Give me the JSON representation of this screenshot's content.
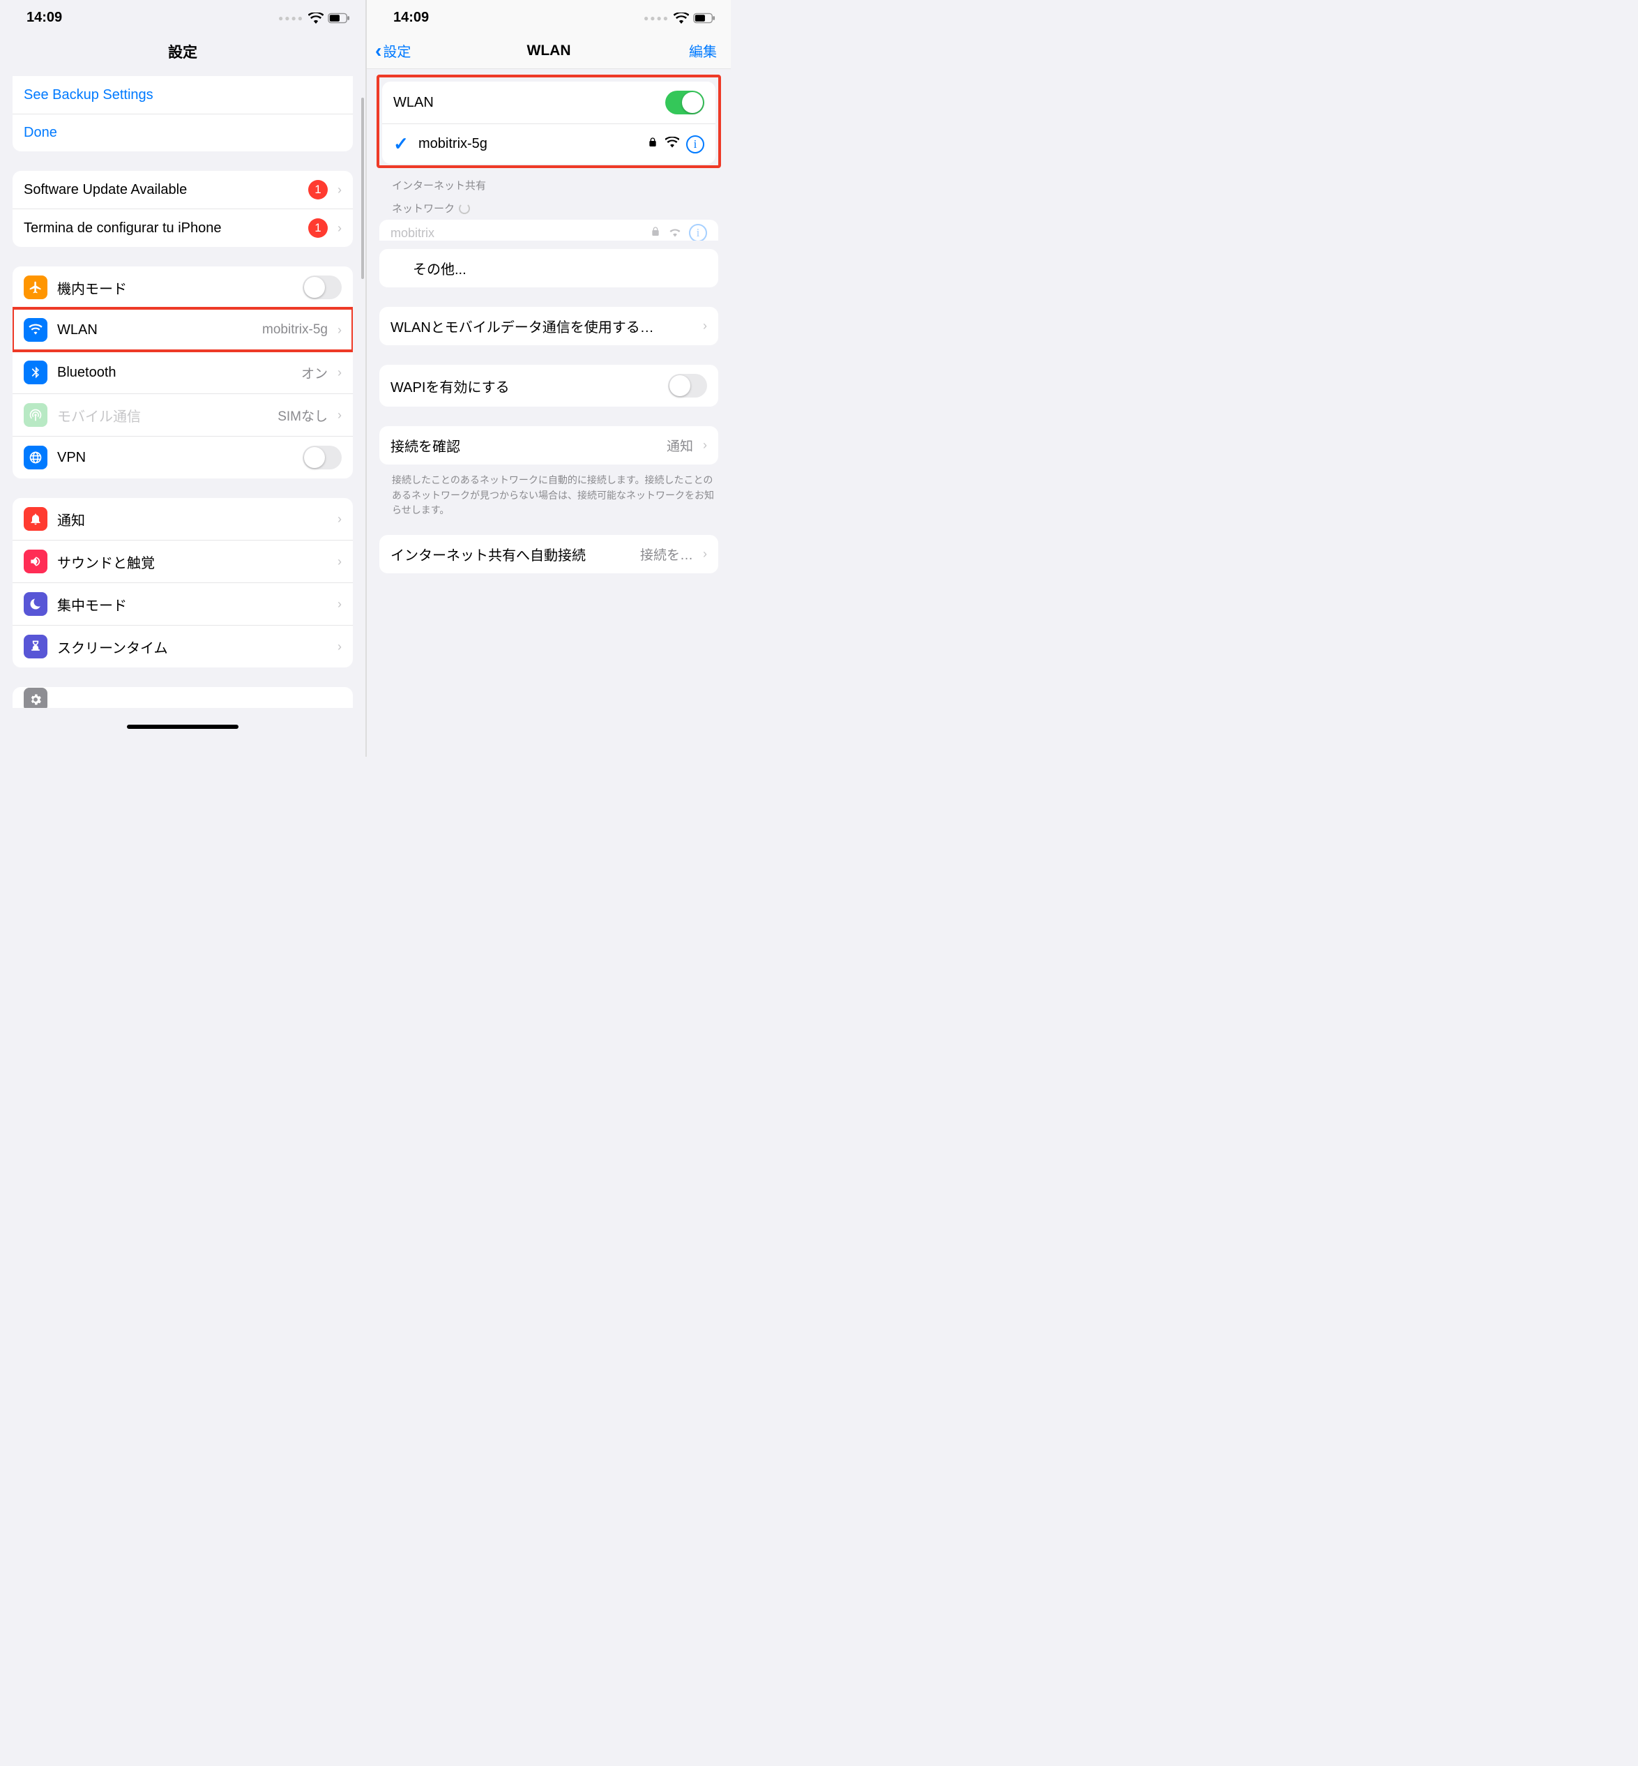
{
  "status": {
    "time": "14:09"
  },
  "left": {
    "title": "設定",
    "top_links": {
      "backup": "See Backup Settings",
      "done": "Done"
    },
    "badges": {
      "update": {
        "label": "Software Update Available",
        "count": "1"
      },
      "finish": {
        "label": "Termina de configurar tu iPhone",
        "count": "1"
      }
    },
    "conn": {
      "airplane": "機内モード",
      "wlan": {
        "label": "WLAN",
        "value": "mobitrix-5g"
      },
      "bluetooth": {
        "label": "Bluetooth",
        "value": "オン"
      },
      "cellular": {
        "label": "モバイル通信",
        "value": "SIMなし"
      },
      "vpn": "VPN"
    },
    "sys": {
      "notifications": "通知",
      "sounds": "サウンドと触覚",
      "focus": "集中モード",
      "screentime": "スクリーンタイム"
    }
  },
  "right": {
    "back": "設定",
    "title": "WLAN",
    "edit": "編集",
    "wlan_toggle_label": "WLAN",
    "connected": "mobitrix-5g",
    "hotspot_header": "インターネット共有",
    "networks_header": "ネットワーク",
    "peek_name": "mobitrix",
    "other": "その他...",
    "apps_label": "WLANとモバイルデータ通信を使用する…",
    "wapi_label": "WAPIを有効にする",
    "ask_join": {
      "label": "接続を確認",
      "value": "通知"
    },
    "ask_footer": "接続したことのあるネットワークに自動的に接続します。接続したことのあるネットワークが見つからない場合は、接続可能なネットワークをお知らせします。",
    "auto_hotspot": {
      "label": "インターネット共有へ自動接続",
      "value": "接続を…"
    }
  }
}
